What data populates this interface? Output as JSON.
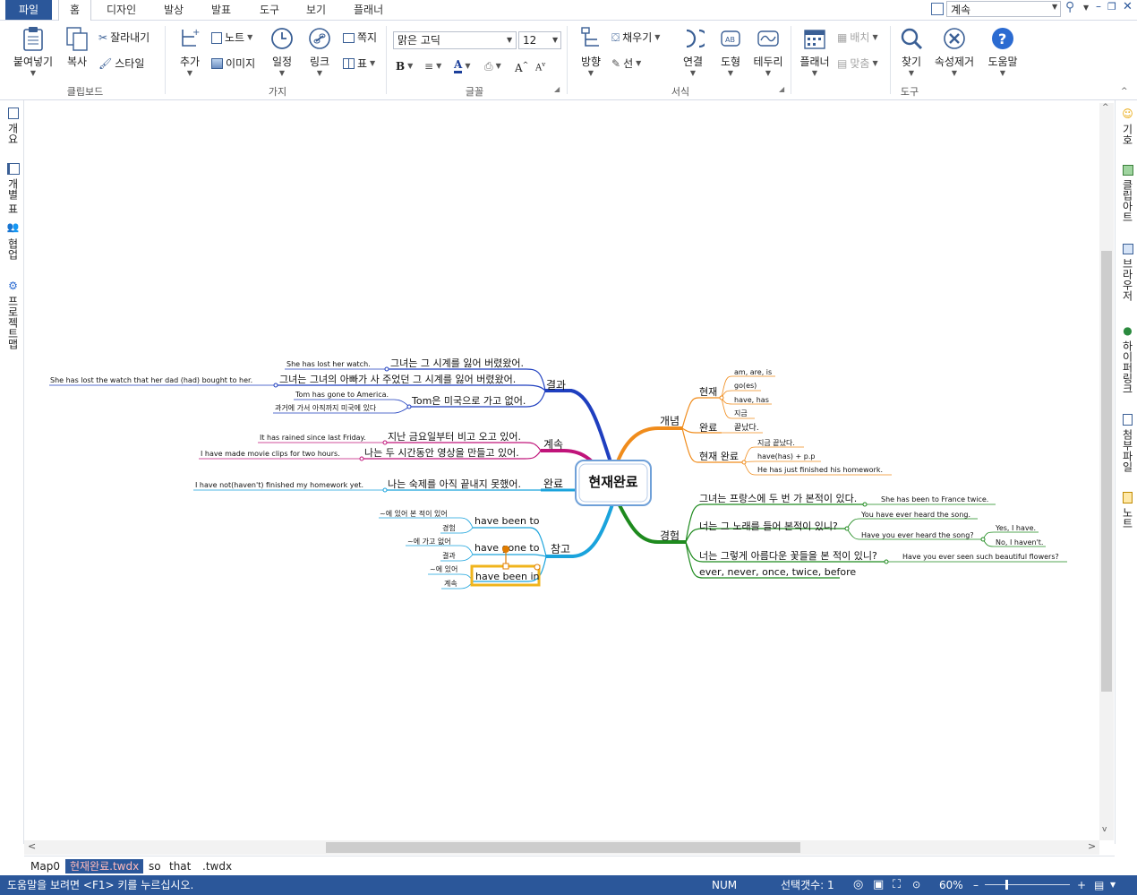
{
  "menu": {
    "file": "파일",
    "tabs": [
      "홈",
      "디자인",
      "발상",
      "발표",
      "도구",
      "보기",
      "플래너"
    ],
    "search_value": "계속"
  },
  "ribbon": {
    "clipboard": {
      "label": "클립보드",
      "paste": "붙여넣기",
      "copy": "복사",
      "cut": "잘라내기",
      "style": "스타일"
    },
    "branch": {
      "label": "가지",
      "add": "추가",
      "note": "노트",
      "image": "이미지",
      "schedule": "일정",
      "link": "링크",
      "memo": "쪽지",
      "table": "표"
    },
    "font": {
      "label": "글꼴",
      "family": "맑은 고딕",
      "size": "12"
    },
    "format": {
      "label": "서식",
      "direction": "방향",
      "fill": "채우기",
      "line": "선",
      "connect": "연결",
      "shape": "도형",
      "border": "테두리"
    },
    "planner": {
      "label": "플래너",
      "arrange": "배치",
      "align": "맞춤"
    },
    "tools": {
      "label": "도구",
      "find": "찾기",
      "clear": "속성제거",
      "help": "도움말"
    }
  },
  "left_panel": [
    "개요",
    "개별 표",
    "협업",
    "프로젝트맵"
  ],
  "right_panel": [
    "기호",
    "클립아트",
    "브라우저",
    "하이퍼링크",
    "첨부파일",
    "노트"
  ],
  "mindmap": {
    "center": "현재완료",
    "nodes": {
      "gyeolgwa": "결과",
      "gyeolgwa_1": "그녀는 그 시계를 잃어 버렸왔어.",
      "gyeolgwa_1_en": "She has lost her watch.",
      "gyeolgwa_2": "그녀는 그녀의 아빠가 사 주었던 그 시계를 잃어 버렸왔어.",
      "gyeolgwa_2_en": "She has lost the watch that her dad (had) bought to her.",
      "gyeolgwa_3": "Tom은 미국으로 가고 없어.",
      "gyeolgwa_3_en": "Tom has gone to America.",
      "gyeolgwa_3_en2": "과거에 가서 아직까지 미국에 있다",
      "gyesok": "계속",
      "gyesok_1": "지난 금요일부터 비고 오고 있어.",
      "gyesok_1_en": "It has rained since last Friday.",
      "gyesok_2": "나는 두 시간동안 영상을 만들고 있어.",
      "gyesok_2_en": "I have made movie clips for two hours.",
      "wanryo": "완료",
      "wanryo_1": "나는 숙제를 아직 끝내지 못했어.",
      "wanryo_1_en": "I have not(haven't) finished my homework yet.",
      "chamgo": "참고",
      "chamgo_1": "have been to",
      "chamgo_1_a": "~에 있어 본 적이 있어",
      "chamgo_1_b": "경험",
      "chamgo_2": "have gone to",
      "chamgo_2_a": "~에 가고 없어",
      "chamgo_2_b": "결과",
      "chamgo_3": "have been in",
      "chamgo_3_a": "~에 있어",
      "chamgo_3_b": "계속",
      "gaenyeom": "개념",
      "hyeonjae": "현재",
      "hyeonjae_1": "am, are, is",
      "hyeonjae_2": "go(es)",
      "hyeonjae_3": "have, has",
      "hyeonjae_4": "지금",
      "wanryo2": "완료",
      "wanryo2_1": "끝났다.",
      "hyeonjae_wanryo": "현재 완료",
      "hw_1": "지금 끝났다.",
      "hw_2": "have(has) + p.p",
      "hw_3": "He has just finished his homework.",
      "gyeongheom": "경험",
      "gh_1": "그녀는 프랑스에 두 번 가 본적이 있다.",
      "gh_1_en": "She has been to France twice.",
      "gh_2": "너는 그 노래를 들어 본적이 있니?",
      "gh_2_a": "You have ever heard the song.",
      "gh_2_b": "Have you ever heard the song?",
      "gh_2_b1": "Yes, I have.",
      "gh_2_b2": "No, I haven't.",
      "gh_3": "너는 그렇게 아름다운 꽃들을 본 적이 있니?",
      "gh_3_en": "Have you ever seen such beautiful flowers?",
      "gh_4": "ever, never, once, twice, before"
    }
  },
  "doc_tabs": [
    "Map0",
    "현재완료.twdx",
    "so",
    "that",
    ".twdx"
  ],
  "status": {
    "help": "도움말을 보려면 <F1> 키를 누르십시오.",
    "num": "NUM",
    "selection": "선택갯수: 1",
    "zoom": "60%"
  },
  "colors": {
    "accent": "#2b579a",
    "result": "#1f3fbf",
    "continuous": "#c0147a",
    "complete": "#1aa3dc",
    "reference": "#1aa3dc",
    "concept": "#f08c1c",
    "experience": "#1e8a1e"
  }
}
